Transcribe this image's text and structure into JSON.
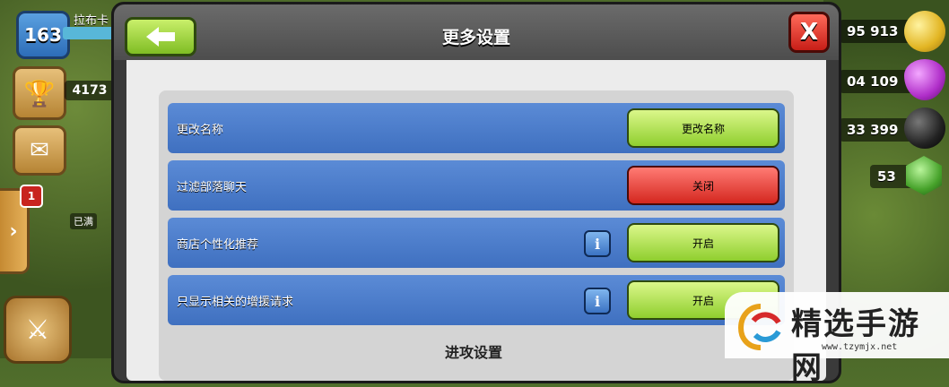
{
  "hud": {
    "level": "163",
    "player_name": "拉布卡",
    "trophies": "4173",
    "notification_count": "1",
    "building_label": "已满"
  },
  "resources": {
    "gold": "95 913",
    "elixir": "04 109",
    "dark_elixir": "33 399",
    "gems": "53"
  },
  "dialog": {
    "title": "更多设置",
    "close_label": "X",
    "rows": [
      {
        "label": "更改名称",
        "button": "更改名称",
        "button_style": "green",
        "has_info": false
      },
      {
        "label": "过滤部落聊天",
        "button": "关闭",
        "button_style": "red",
        "has_info": false
      },
      {
        "label": "商店个性化推荐",
        "button": "开启",
        "button_style": "green",
        "has_info": true
      },
      {
        "label": "只显示相关的增援请求",
        "button": "开启",
        "button_style": "green",
        "has_info": true
      }
    ],
    "section_title": "进攻设置"
  },
  "watermark": {
    "text": "精选手游网",
    "url": "www.tzymjx.net"
  },
  "colors": {
    "row_blue": "#4a7bcb",
    "button_green": "#8fcf2e",
    "button_red": "#d4271f"
  }
}
